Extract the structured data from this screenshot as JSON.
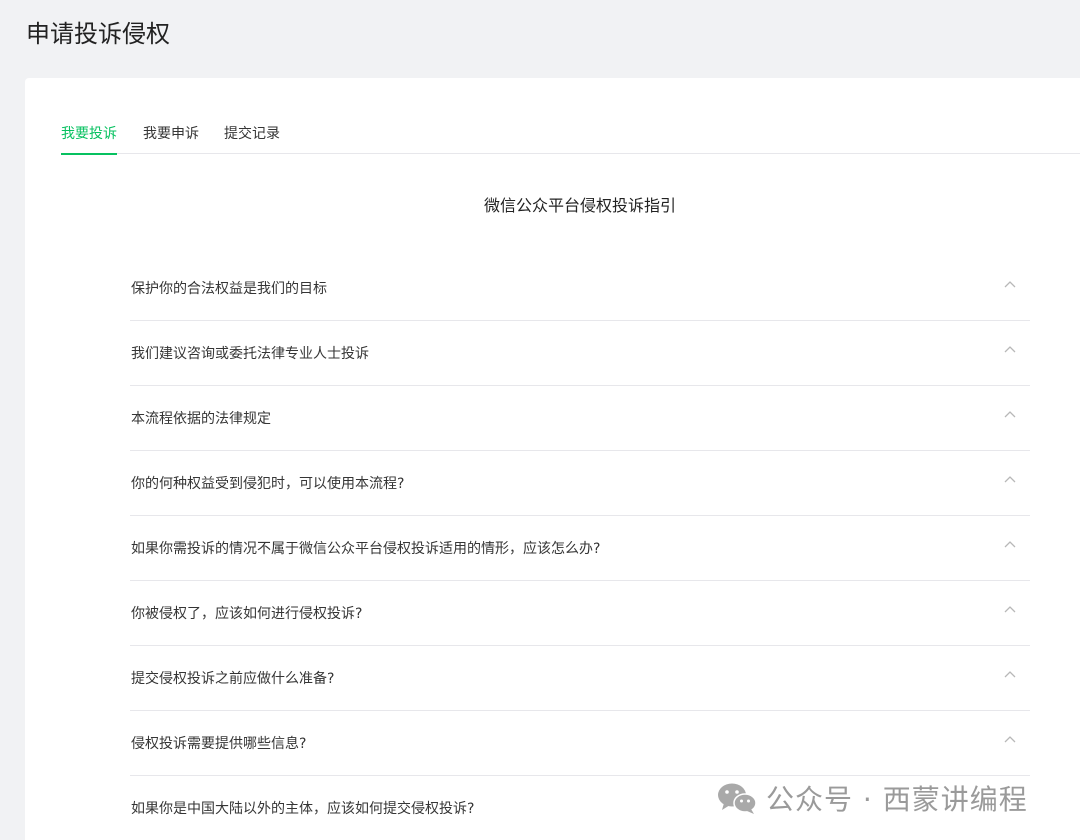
{
  "page": {
    "title": "申请投诉侵权"
  },
  "tabs": [
    {
      "label": "我要投诉",
      "active": true
    },
    {
      "label": "我要申诉",
      "active": false
    },
    {
      "label": "提交记录",
      "active": false
    }
  ],
  "guide": {
    "title": "微信公众平台侵权投诉指引",
    "items": [
      {
        "question": "保护你的合法权益是我们的目标"
      },
      {
        "question": "我们建议咨询或委托法律专业人士投诉"
      },
      {
        "question": "本流程依据的法律规定"
      },
      {
        "question": "你的何种权益受到侵犯时，可以使用本流程?"
      },
      {
        "question": "如果你需投诉的情况不属于微信公众平台侵权投诉适用的情形，应该怎么办?"
      },
      {
        "question": "你被侵权了，应该如何进行侵权投诉?"
      },
      {
        "question": "提交侵权投诉之前应做什么准备?"
      },
      {
        "question": "侵权投诉需要提供哪些信息?"
      },
      {
        "question": "如果你是中国大陆以外的主体，应该如何提交侵权投诉?"
      }
    ]
  },
  "watermark": {
    "text": "公众号 · 西蒙讲编程",
    "icon": "wechat-icon"
  },
  "colors": {
    "accent": "#07c160",
    "background": "#f1f2f4",
    "card": "#ffffff"
  }
}
